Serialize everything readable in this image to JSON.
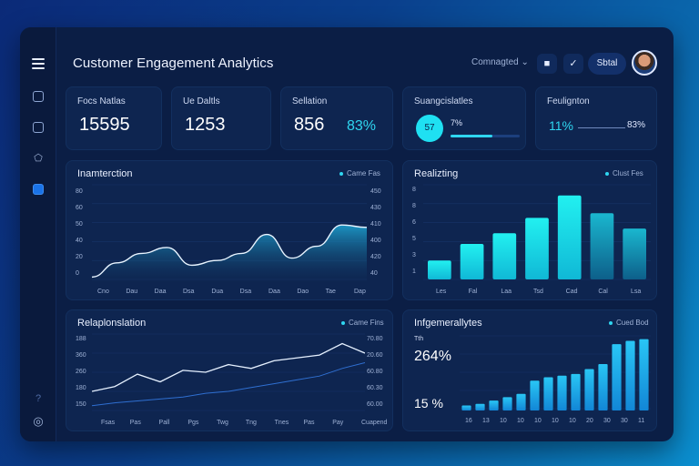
{
  "header": {
    "title": "Customer Engagement Analytics",
    "dropdown_label": "Comnagted",
    "pill_label": "Sbtal"
  },
  "sidebar": {
    "icons": [
      "menu-icon",
      "report-icon",
      "image-icon",
      "tag-icon",
      "chart-icon",
      "help-icon",
      "settings-icon"
    ]
  },
  "kpis": [
    {
      "label": "Focs Natlas",
      "value": "15595"
    },
    {
      "label": "Ue Daltls",
      "value": "1253"
    },
    {
      "label": "Sellation",
      "value": "856",
      "extra": "83%"
    },
    {
      "label": "Suangcislatles",
      "badge": "57",
      "extra": "7%"
    },
    {
      "label": "Feulignton",
      "value": "11%",
      "extra": "83%"
    }
  ],
  "panels": {
    "interaction": {
      "title": "Inamterction",
      "legend": "Came Fas",
      "y_left": [
        "80",
        "60",
        "50",
        "40",
        "20",
        "0"
      ],
      "y_right": [
        "450",
        "430",
        "410",
        "400",
        "420",
        "40"
      ],
      "x_labels": [
        "Cno",
        "Dau",
        "Daa",
        "Dsa",
        "Dua",
        "Dsa",
        "Daa",
        "Dao",
        "Tae",
        "Dap"
      ]
    },
    "realizing": {
      "title": "Realizting",
      "legend": "Clust Fes",
      "y_labels": [
        "8",
        "8",
        "6",
        "5",
        "3",
        "1"
      ],
      "x_labels": [
        "Les",
        "Fal",
        "Laa",
        "Tsd",
        "Cad",
        "Cal",
        "Lsa"
      ]
    },
    "relationship": {
      "title": "Relaplonslation",
      "legend": "Came Fins",
      "y_left": [
        "188",
        "360",
        "260",
        "180",
        "150"
      ],
      "y_right": [
        "70.80",
        "20.60",
        "60.80",
        "60.30",
        "60.00"
      ],
      "x_labels": [
        "Fsas",
        "Pas",
        "Pall",
        "Pgs",
        "Twg",
        "Tng",
        "Tnes",
        "Pas",
        "Pay",
        "Cuapend"
      ]
    },
    "engagement": {
      "title": "Infgemerallytes",
      "legend": "Cued Bod",
      "stat_small": "Tth",
      "stat_main": "264%",
      "stat_bottom": "15 %",
      "x_labels": [
        "16",
        "13",
        "10",
        "10",
        "10",
        "10",
        "10",
        "20",
        "30",
        "30",
        "11"
      ]
    }
  },
  "chart_data": [
    {
      "type": "area",
      "title": "Inamterction",
      "categories": [
        "Cno",
        "Dau",
        "Daa",
        "Dsa",
        "Dua",
        "Dsa",
        "Daa",
        "Dao",
        "Tae",
        "Dap"
      ],
      "series": [
        {
          "values": [
            2,
            14,
            22,
            27,
            12,
            16,
            22,
            38,
            18,
            28,
            46,
            44
          ]
        }
      ],
      "ylim": [
        0,
        80
      ]
    },
    {
      "type": "bar",
      "title": "Realizting",
      "categories": [
        "Les",
        "Fal",
        "Laa",
        "Tsd",
        "Cad",
        "Cal",
        "Lsa"
      ],
      "values": [
        1.6,
        3,
        3.9,
        5.2,
        7.1,
        5.6,
        4.3
      ],
      "ylim": [
        0,
        8
      ]
    },
    {
      "type": "line",
      "title": "Relaplonslation",
      "categories": [
        "Fsas",
        "Pas",
        "Pall",
        "Pgs",
        "Twg",
        "Tng",
        "Tnes",
        "Pas",
        "Pay",
        "Cuapend"
      ],
      "series": [
        {
          "values": [
            20,
            25,
            38,
            30,
            42,
            40,
            48,
            44,
            52,
            55,
            58,
            70,
            60
          ]
        },
        {
          "values": [
            5,
            8,
            10,
            12,
            14,
            18,
            20,
            24,
            28,
            32,
            36,
            44,
            50
          ]
        }
      ],
      "ylim": [
        0,
        80
      ]
    },
    {
      "type": "bar",
      "title": "Infgemerallytes",
      "categories": [
        "16",
        "13",
        "10",
        "10",
        "10",
        "10",
        "10",
        "20",
        "30",
        "30",
        "11"
      ],
      "values": [
        3,
        4,
        6,
        8,
        10,
        18,
        20,
        21,
        22,
        25,
        28,
        40,
        42,
        43
      ],
      "ylim": [
        0,
        45
      ]
    }
  ]
}
